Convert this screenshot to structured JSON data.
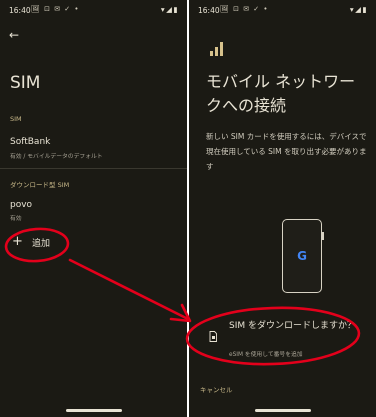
{
  "left": {
    "status": {
      "time": "16:40",
      "notifs": "🖼 ⊡ ✉ ✓ •",
      "sys": "▾◢▮"
    },
    "title": "SIM",
    "sim_section_label": "SIM",
    "sim1": {
      "name": "SoftBank",
      "sub": "有効 / モバイルデータのデフォルト"
    },
    "download_section_label": "ダウンロード型 SIM",
    "sim2": {
      "name": "povo",
      "sub": "有効"
    },
    "add": {
      "plus": "+",
      "label": "追加"
    }
  },
  "right": {
    "status": {
      "time": "16:40",
      "notifs": "🖼 ⊡ ✉ ✓ •",
      "sys": "▾◢▮"
    },
    "title": "モバイル ネットワークへの接続",
    "description": "新しい SIM カードを使用するには、デバイスで現在使用している SIM を取り出す必要があります",
    "phone_logo": "G",
    "download": {
      "title": "SIM をダウンロードしますか？",
      "subtitle": "eSIM を使用して番号を追加"
    },
    "cancel": "キャンセル"
  },
  "colors": {
    "background": "#1b1a14",
    "text": "#e8e3d4",
    "accent": "#c9b98a",
    "annotation": "#e3001b"
  },
  "icons": {
    "back": "back-arrow-icon",
    "signal": "signal-bars-icon",
    "sim": "sim-card-icon",
    "google": "google-logo-icon"
  }
}
